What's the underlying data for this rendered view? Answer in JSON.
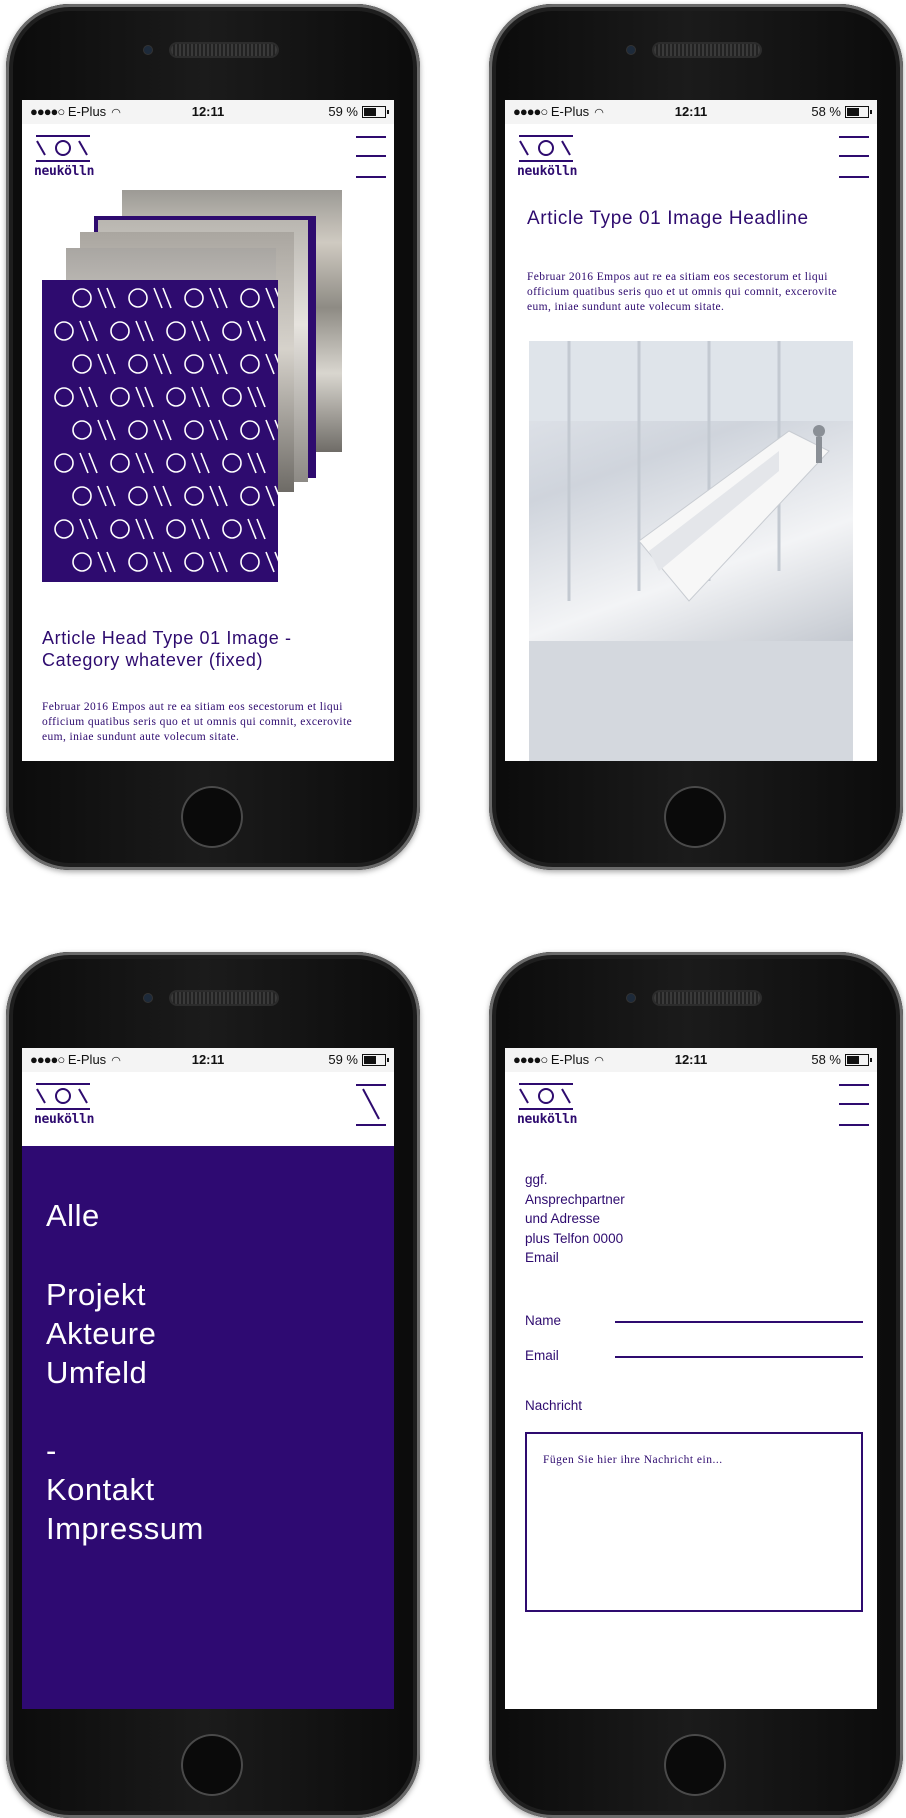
{
  "brand": {
    "logo_text": "neukölln",
    "accent_color": "#2e0b6f"
  },
  "status_bars": [
    {
      "carrier": "E-Plus",
      "time": "12:11",
      "battery": "59 %"
    },
    {
      "carrier": "E-Plus",
      "time": "12:11",
      "battery": "58 %"
    },
    {
      "carrier": "E-Plus",
      "time": "12:11",
      "battery": "59 %"
    },
    {
      "carrier": "E-Plus",
      "time": "12:11",
      "battery": "58 %"
    }
  ],
  "screen1": {
    "headline": "Article Head Type 01 Image - Category whatever (fixed)",
    "body": "Februar 2016 Empos aut re ea sitiam eos secestorum et liqui officium quatibus seris quo et ut omnis qui comnit, excerovite eum, iniae sundunt aute volecum sitate."
  },
  "screen2": {
    "headline": "Article Type 01 Image Headline",
    "body": "Februar 2016 Empos aut re ea sitiam eos secestorum et liqui officium quatibus seris quo et ut omnis qui comnit, excerovite eum, iniae sundunt aute volecum sitate."
  },
  "screen3": {
    "menu_items": [
      "Alle",
      "Projekt",
      "Akteure",
      "Umfeld",
      "-",
      "Kontakt",
      "Impressum"
    ]
  },
  "screen4": {
    "contact_lines": [
      "ggf.",
      "Ansprechpartner",
      "und Adresse",
      "plus Telfon 0000",
      "Email"
    ],
    "name_label": "Name",
    "email_label": "Email",
    "message_label": "Nachricht",
    "message_placeholder": "Fügen Sie hier ihre Nachricht ein..."
  }
}
